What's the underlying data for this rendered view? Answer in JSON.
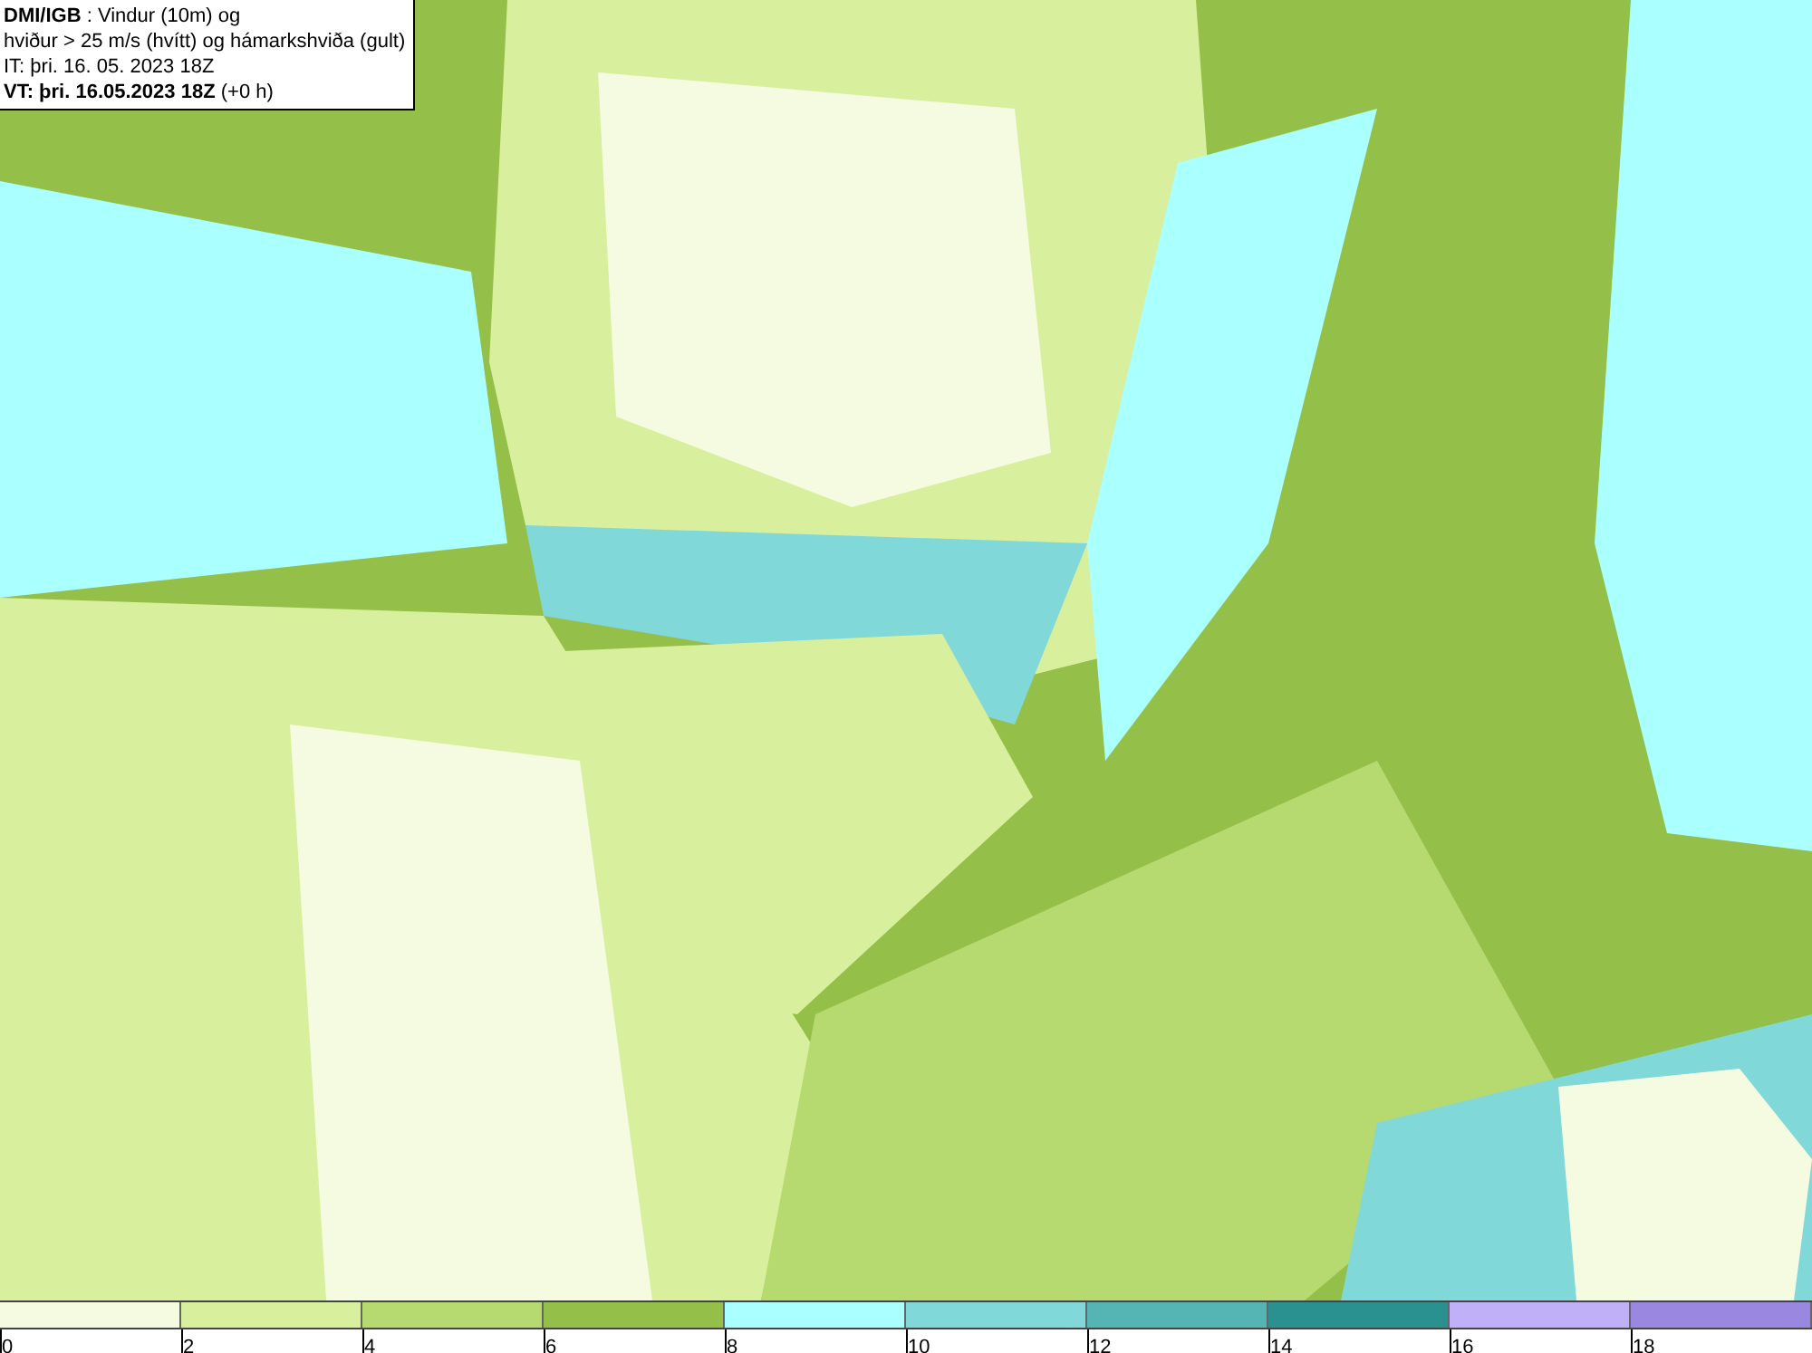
{
  "header": {
    "lines": [
      "**DMI/IGB** : Vindur (10m) og",
      "hviður > 25 m/s (hvítt) og hámarkshviða (gult)",
      "IT: þri. 16. 05. 2023 18Z",
      "**VT: þri. 16.05.2023 18Z** (+0 h)"
    ]
  },
  "legend": {
    "segments": [
      {
        "color": "#f5fbe0"
      },
      {
        "color": "#d8ef9e"
      },
      {
        "color": "#b6d970"
      },
      {
        "color": "#94bf48"
      },
      {
        "color": "#aaffff"
      },
      {
        "color": "#80d8d8"
      },
      {
        "color": "#55b4b4"
      },
      {
        "color": "#2a9090"
      },
      {
        "color": "#c0b0f8"
      },
      {
        "color": "#9a88e0"
      }
    ],
    "ticks": [
      "0",
      "2",
      "4",
      "6",
      "8",
      "10",
      "12",
      "14",
      "16",
      "18"
    ]
  }
}
